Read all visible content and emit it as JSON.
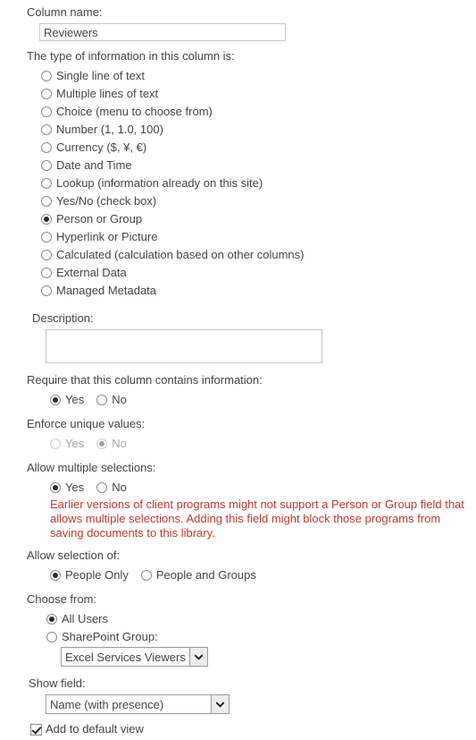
{
  "column_name": {
    "label": "Column name:",
    "value": "Reviewers",
    "placeholder": ""
  },
  "type_section": {
    "label": "The type of information in this column is:",
    "options": [
      {
        "label": "Single line of text",
        "checked": false
      },
      {
        "label": "Multiple lines of text",
        "checked": false
      },
      {
        "label": "Choice (menu to choose from)",
        "checked": false
      },
      {
        "label": "Number (1, 1.0, 100)",
        "checked": false
      },
      {
        "label": "Currency ($, ¥, €)",
        "checked": false
      },
      {
        "label": "Date and Time",
        "checked": false
      },
      {
        "label": "Lookup (information already on this site)",
        "checked": false
      },
      {
        "label": "Yes/No (check box)",
        "checked": false
      },
      {
        "label": "Person or Group",
        "checked": true
      },
      {
        "label": "Hyperlink or Picture",
        "checked": false
      },
      {
        "label": "Calculated (calculation based on other columns)",
        "checked": false
      },
      {
        "label": "External Data",
        "checked": false
      },
      {
        "label": "Managed Metadata",
        "checked": false
      }
    ]
  },
  "description": {
    "label": "Description:",
    "value": "",
    "placeholder": ""
  },
  "required": {
    "label": "Require that this column contains information:",
    "yes_label": "Yes",
    "no_label": "No",
    "selected": "Yes",
    "disabled": false
  },
  "unique": {
    "label": "Enforce unique values:",
    "yes_label": "Yes",
    "no_label": "No",
    "selected": "No",
    "disabled": true
  },
  "multiple": {
    "label": "Allow multiple selections:",
    "yes_label": "Yes",
    "no_label": "No",
    "selected": "Yes",
    "disabled": false,
    "warning": "Earlier versions of client programs might not support a Person or Group field that allows multiple selections. Adding this field might block those programs from saving documents to this library.",
    "warning_color": "#c0392b"
  },
  "allow_selection": {
    "label": "Allow selection of:",
    "options": [
      {
        "label": "People Only",
        "checked": true
      },
      {
        "label": "People and Groups",
        "checked": false
      }
    ]
  },
  "choose_from": {
    "label": "Choose from:",
    "options": [
      {
        "label": "All Users",
        "checked": true
      },
      {
        "label": "SharePoint Group:",
        "checked": false
      }
    ],
    "group_select": {
      "value": "Excel Services Viewers",
      "icon": "chevron-down-icon"
    }
  },
  "show_field": {
    "label": "Show field:",
    "value": "Name (with presence)",
    "icon": "chevron-down-icon"
  },
  "default_view": {
    "label": "Add to default view",
    "checked": true
  }
}
